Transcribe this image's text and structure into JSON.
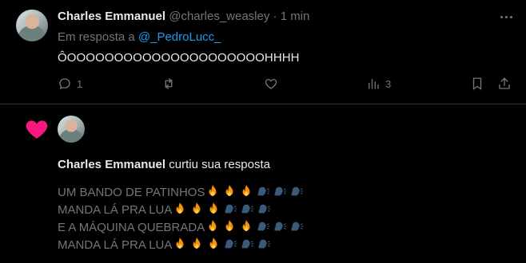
{
  "tweet": {
    "author": "Charles Emmanuel",
    "handle": "@charles_weasley",
    "separator": "·",
    "time": "1 min",
    "reply_prefix": "Em resposta a ",
    "reply_mention": "@_PedroLucc_",
    "text": "ÔOOOOOOOOOOOOOOOOOOOOOHHHH",
    "actions": {
      "reply_count": "1",
      "views_count": "3"
    },
    "icons": [
      "more-icon",
      "reply-icon",
      "retweet-icon",
      "like-icon",
      "views-icon",
      "bookmark-icon",
      "share-icon"
    ]
  },
  "notification": {
    "icon": "heart-icon",
    "actor": "Charles Emmanuel",
    "action_text": " curtiu sua resposta",
    "quote_lines": [
      {
        "text": "UM BANDO DE PATINHOS",
        "emojis": [
          "fire",
          "fire",
          "fire",
          "speaking-head",
          "speaking-head",
          "speaking-head"
        ]
      },
      {
        "text": "MANDA LÁ PRA LUA",
        "emojis": [
          "fire",
          "fire",
          "fire",
          "speaking-head",
          "speaking-head",
          "speaking-head"
        ]
      },
      {
        "text": "E A MÁQUINA QUEBRADA",
        "emojis": [
          "fire",
          "fire",
          "fire",
          "speaking-head",
          "speaking-head",
          "speaking-head"
        ]
      },
      {
        "text": "MANDA LÁ PRA LUA",
        "emojis": [
          "fire",
          "fire",
          "fire",
          "speaking-head",
          "speaking-head",
          "speaking-head"
        ]
      }
    ]
  },
  "colors": {
    "background": "#000000",
    "text": "#e7e9ea",
    "muted": "#71767b",
    "link": "#1d9bf0",
    "heart": "#f91880",
    "divider": "#2f3336"
  }
}
